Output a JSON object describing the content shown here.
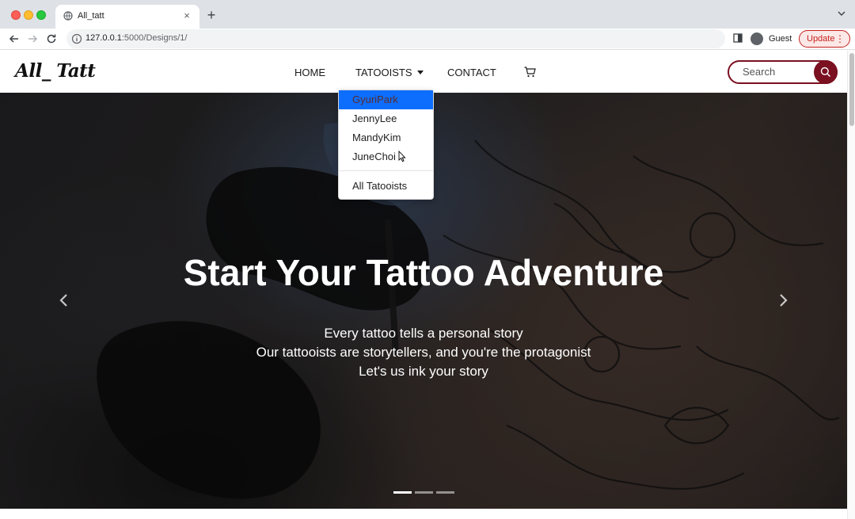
{
  "browser": {
    "tab_title": "All_tatt",
    "tab_close": "×",
    "new_tab": "+",
    "url_host": "127.0.0.1",
    "url_path": ":5000/Designs/1/",
    "profile_name": "Guest",
    "update_label": "Update",
    "update_menu": "⋮"
  },
  "site": {
    "brand": "All_ Tatt",
    "nav": {
      "home": "HOME",
      "tattooists": "TATOOISTS",
      "contact": "CONTACT"
    },
    "search_placeholder": "Search",
    "dropdown": {
      "items": [
        "GyuriPark",
        "JennyLee",
        "MandyKim",
        "JuneChoi"
      ],
      "all_label": "All Tatooists",
      "active_index": 0
    },
    "hero": {
      "title": "Start Your Tattoo Adventure",
      "line1": "Every tattoo tells a personal story",
      "line2": "Our tattooists are storytellers, and you're the protagonist",
      "line3": "Let's us ink your story",
      "slide_count": 3,
      "active_slide": 1
    }
  },
  "colors": {
    "accent": "#7a1020",
    "dropdown_active": "#0d6efd",
    "update": "#c5221f"
  }
}
